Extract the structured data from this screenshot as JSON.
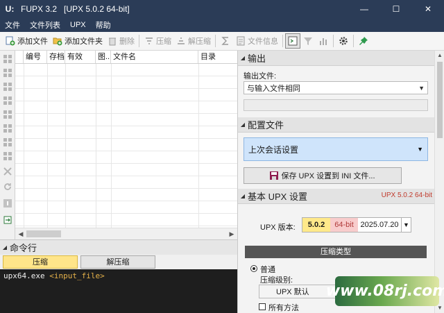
{
  "window": {
    "logo": "U:",
    "title": "FUPX 3.2   [UPX 5.0.2 64-bit]",
    "minimize": "—",
    "maximize": "☐",
    "close": "✕"
  },
  "menu": [
    "文件",
    "文件列表",
    "UPX",
    "帮助"
  ],
  "toolbar": {
    "add_file": "添加文件",
    "add_folder": "添加文件夹",
    "delete": "删除",
    "compress": "压缩",
    "decompress": "解压缩",
    "file_info": "文件信息",
    "icons": [
      "sigma-icon",
      "console-toggle-icon",
      "filter-icon",
      "chart-icon",
      "gear-icon",
      "pin-icon"
    ]
  },
  "file_table": {
    "columns": [
      "编号",
      "存档",
      "有效",
      "图...",
      "文件名",
      "目录"
    ],
    "rows": []
  },
  "command_panel": {
    "title": "命令行",
    "tabs": [
      "压缩",
      "解压缩"
    ],
    "active_tab": "压缩",
    "command": "upx64.exe",
    "argument": "<input_file>"
  },
  "output": {
    "title": "输出",
    "output_file_label": "输出文件:",
    "output_file_value": "与输入文件相同",
    "output_path_value": ""
  },
  "profile": {
    "title": "配置文件",
    "selected": "上次会话设置",
    "save_button": "保存 UPX 设置到 INI 文件..."
  },
  "basic_upx": {
    "title": "基本 UPX 设置",
    "version_badge": "UPX 5.0.2 64-bit",
    "version_label": "UPX 版本:",
    "version": "5.0.2",
    "bitness": "64-bit",
    "date": "2025.07.20",
    "compression_type_title": "压缩类型",
    "normal_option": "普通",
    "level_label": "压缩级别:",
    "level_value": "UPX 默认",
    "all_methods_label": "所有方法"
  },
  "watermark": "www.08rj.com",
  "colors": {
    "titlebar": "#2b3c57",
    "active_tab": "#ffe58a",
    "profile_combo": "#cfe4fb",
    "console_bg": "#1e1e1e",
    "version_badge": "#c0392b"
  }
}
